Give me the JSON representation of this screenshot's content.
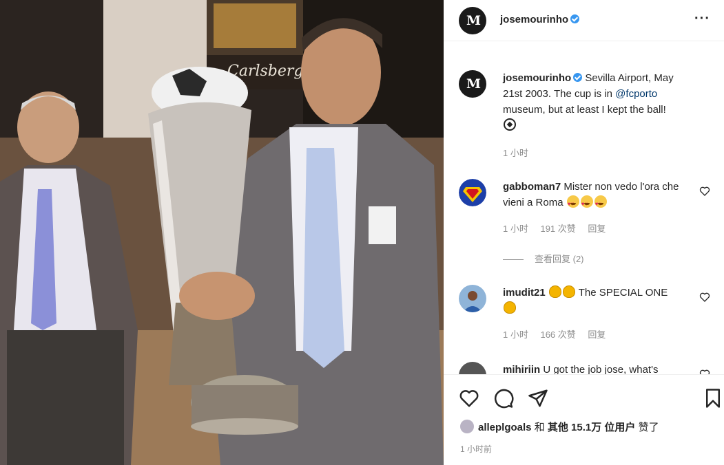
{
  "photo": {
    "sign_text": "Carlsberg"
  },
  "post": {
    "username": "josemourinho",
    "avatar_letters": "M",
    "more_icon": "more-icon"
  },
  "caption": {
    "username": "josemourinho",
    "text_before_mention": " Sevilla Airport, May 21st 2003. The cup is in ",
    "mention": "@fcporto",
    "text_after_mention": " museum, but at least I kept the ball! ",
    "emoji": "soccer-ball",
    "time": "1 小时"
  },
  "comments": [
    {
      "username": "gabboman7",
      "text": " Mister non vedo l'ora che vieni a Roma ",
      "emojis": [
        "heart-eyes",
        "heart-eyes",
        "heart-eyes"
      ],
      "time": "1 小时",
      "likes": "191 次赞",
      "reply": "回复",
      "view_replies": "查看回复 (2)"
    },
    {
      "username": "imudit21",
      "text_before": " ",
      "text": " The SPECIAL ONE",
      "emojis": [
        "clapping-hands",
        "clapping-hands",
        "clapping-hands"
      ],
      "time": "1 小时",
      "likes": "166 次赞",
      "reply": "回复"
    },
    {
      "username": "mihiriin",
      "text": " U got the job jose, what's"
    }
  ],
  "actions": {
    "likes_username": "alleplgoals",
    "likes_middle": " 和 ",
    "likes_others": "其他 15.1万 位用户",
    "likes_suffix": " 赞了",
    "post_time": "1 小时前"
  },
  "colors": {
    "verified": "#3897f0",
    "mention": "#00376b",
    "meta": "#8e8e8e"
  }
}
